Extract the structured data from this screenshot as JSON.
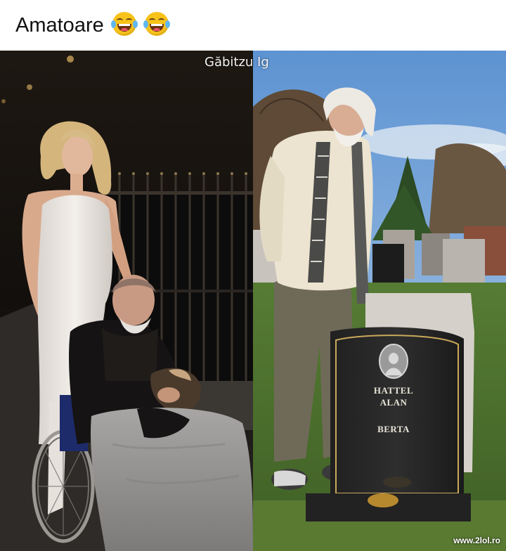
{
  "post": {
    "caption": "Amatoare"
  },
  "images": {
    "watermark_author": "Găbitzu Ig",
    "watermark_site": "www.2lol.ro",
    "gravestone": {
      "line1": "HATTEL",
      "line2": "ALAN",
      "line3": "BERTA"
    }
  },
  "colors": {
    "emoji_face": "#f7c21a",
    "background": "#ffffff"
  },
  "icons": [
    "tears-of-joy-icon",
    "tears-of-joy-icon"
  ]
}
